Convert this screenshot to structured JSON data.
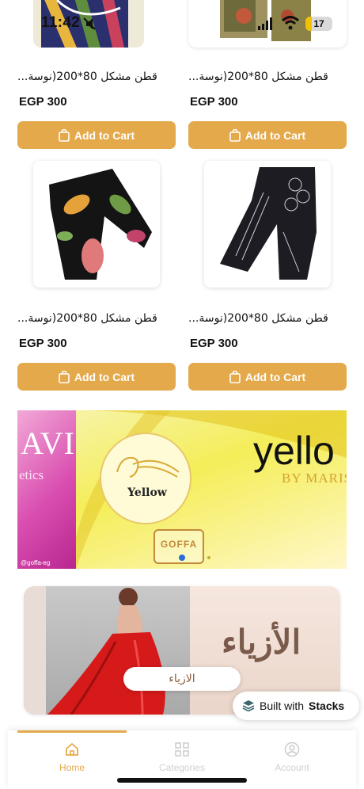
{
  "status": {
    "time": "11:42",
    "battery": "17"
  },
  "products": [
    {
      "title": "قطن مشكل 80*200(نوسة...",
      "price": "EGP 300",
      "cart_label": "Add to Cart"
    },
    {
      "title": "قطن مشكل 80*200(نوسة...",
      "price": "EGP 300",
      "cart_label": "Add to Cart"
    },
    {
      "title": "قطن مشكل 80*200(نوسة...",
      "price": "EGP 300",
      "cart_label": "Add to Cart"
    },
    {
      "title": "قطن مشكل 80*200(نوسة...",
      "price": "EGP 300",
      "cart_label": "Add to Cart"
    }
  ],
  "banner": {
    "left_text": "AVI",
    "left_sub": "etics",
    "left_tag": "@goffa-eg",
    "circle_text": "Yellow",
    "big_text": "yello",
    "by_text": "BY MARIS",
    "logo_text": "GOFFA"
  },
  "category": {
    "title": "الأزياء",
    "button_label": "الازياء"
  },
  "badge": {
    "prefix": "Built with",
    "brand": "Stacks"
  },
  "tabs": [
    {
      "label": "Home",
      "icon": "home-icon",
      "active": true
    },
    {
      "label": "Categories",
      "icon": "grid-icon",
      "active": false
    },
    {
      "label": "Account",
      "icon": "account-icon",
      "active": false
    }
  ],
  "colors": {
    "accent": "#e4a94b",
    "banner_yellow": "#f4ee59",
    "banner_pink": "#d94eb0",
    "cat_brown": "#7a5a4b"
  }
}
